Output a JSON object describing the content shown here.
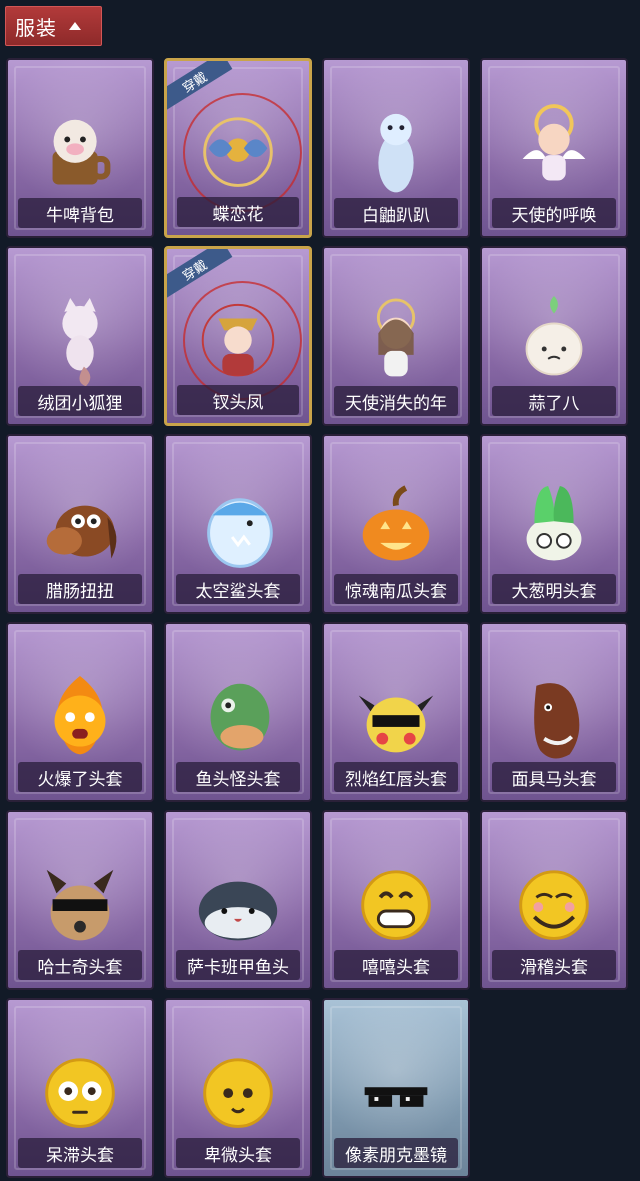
{
  "header": {
    "title": "服装"
  },
  "items": [
    {
      "label": "牛啤背包",
      "equipped": false,
      "badge": "",
      "art": "cow-mug"
    },
    {
      "label": "蝶恋花",
      "equipped": true,
      "badge": "穿戴",
      "art": "butterfly-ornament"
    },
    {
      "label": "白鼬趴趴",
      "equipped": false,
      "badge": "",
      "art": "white-ferret"
    },
    {
      "label": "天使的呼唤",
      "equipped": false,
      "badge": "",
      "art": "angel-doll"
    },
    {
      "label": "绒团小狐狸",
      "equipped": false,
      "badge": "",
      "art": "fox-plush"
    },
    {
      "label": "钗头凤",
      "equipped": true,
      "badge": "穿戴",
      "art": "phoenix-crown-doll"
    },
    {
      "label": "天使消失的年",
      "equipped": false,
      "badge": "",
      "art": "angel-girl"
    },
    {
      "label": "蒜了八",
      "equipped": false,
      "badge": "",
      "art": "garlic"
    },
    {
      "label": "腊肠扭扭",
      "equipped": false,
      "badge": "",
      "art": "dachshund-mask"
    },
    {
      "label": "太空鲨头套",
      "equipped": false,
      "badge": "",
      "art": "space-shark-mask"
    },
    {
      "label": "惊魂南瓜头套",
      "equipped": false,
      "badge": "",
      "art": "pumpkin-mask"
    },
    {
      "label": "大葱明头套",
      "equipped": false,
      "badge": "",
      "art": "green-onion-mask"
    },
    {
      "label": "火爆了头套",
      "equipped": false,
      "badge": "",
      "art": "fire-mask"
    },
    {
      "label": "鱼头怪头套",
      "equipped": false,
      "badge": "",
      "art": "fish-head-mask"
    },
    {
      "label": "烈焰红唇头套",
      "equipped": false,
      "badge": "",
      "art": "yellow-mouse-mask"
    },
    {
      "label": "面具马头套",
      "equipped": false,
      "badge": "",
      "art": "horse-mask"
    },
    {
      "label": "哈士奇头套",
      "equipped": false,
      "badge": "",
      "art": "husky-mask"
    },
    {
      "label": "萨卡班甲鱼头",
      "equipped": false,
      "badge": "",
      "art": "sacabambaspis-mask"
    },
    {
      "label": "嘻嘻头套",
      "equipped": false,
      "badge": "",
      "art": "grin-emoji-mask"
    },
    {
      "label": "滑稽头套",
      "equipped": false,
      "badge": "",
      "art": "funny-emoji-mask"
    },
    {
      "label": "呆滞头套",
      "equipped": false,
      "badge": "",
      "art": "stare-emoji-mask"
    },
    {
      "label": "卑微头套",
      "equipped": false,
      "badge": "",
      "art": "humble-emoji-mask"
    },
    {
      "label": "像素朋克墨镜",
      "equipped": false,
      "badge": "",
      "art": "pixel-sunglasses",
      "special": true
    }
  ],
  "colors": {
    "background": "#121a27",
    "card_purple": "#8a6aa7",
    "card_blue": "#7f9ab0",
    "header_red": "#b23a3a",
    "equipped_border": "#c9a44a"
  }
}
